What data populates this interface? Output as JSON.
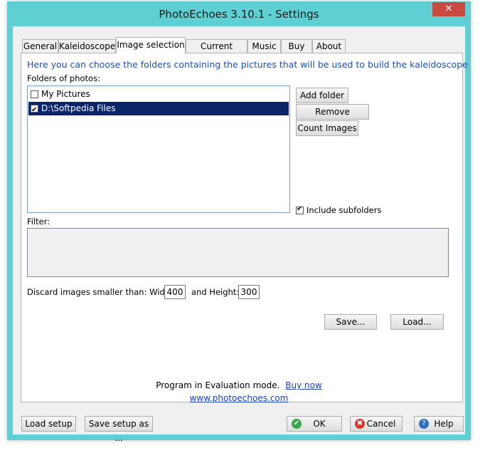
{
  "window": {
    "title": "PhotoEchoes 3.10.1  -  Settings",
    "close_glyph": "✕"
  },
  "tabs": [
    "General",
    "Kaleidoscope",
    "Image selection",
    "Current Image",
    "Music",
    "Buy",
    "About"
  ],
  "image_selection": {
    "hint": "Here you can choose the folders containing the pictures that will be used to build the kaleidoscope",
    "folders_label": "Folders of photos:",
    "folders": [
      {
        "name": "My Pictures",
        "checked": false,
        "selected": false
      },
      {
        "name": "D:\\Softpedia Files",
        "checked": true,
        "selected": true
      }
    ],
    "add_folder": "Add folder",
    "remove_selected": "Remove selected",
    "count_images": "Count Images",
    "include_subfolders": "Include subfolders",
    "include_subfolders_checked": true,
    "filter_label": "Filter:",
    "discard_label": "Discard images smaller than: Width:",
    "width_value": "400",
    "height_label": "and Height:",
    "height_value": "300",
    "save": "Save...",
    "load": "Load..."
  },
  "footer": {
    "eval_text": "Program in Evaluation mode.",
    "buy_now": "Buy now",
    "website": "www.photoechoes.com"
  },
  "bottom_buttons": {
    "load_setup": "Load setup",
    "save_setup": "Save setup as ...",
    "ok": "OK",
    "cancel": "Cancel",
    "help": "Help"
  },
  "icons": {
    "ok_icon": "✔",
    "cancel_icon": "✖",
    "help_icon": "?"
  },
  "colors": {
    "title_bar": "#5ecfd2",
    "selection": "#0a246a",
    "hint_text": "#1f4fa8",
    "close_button": "#c94a40"
  }
}
